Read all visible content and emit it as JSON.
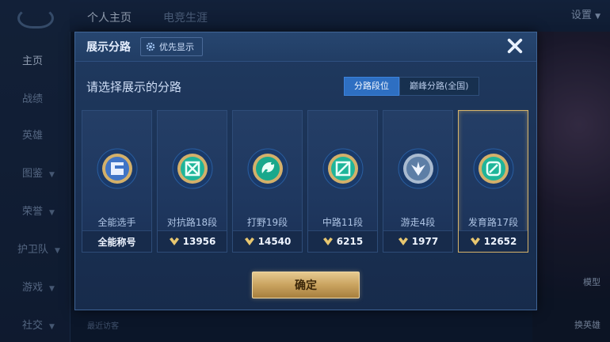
{
  "background": {
    "nav": [
      {
        "label": "主页",
        "active": true
      },
      {
        "label": "战绩",
        "active": false
      },
      {
        "label": "英雄",
        "active": false
      },
      {
        "label": "图鉴",
        "active": false
      },
      {
        "label": "荣誉",
        "active": false
      },
      {
        "label": "护卫队",
        "active": false
      },
      {
        "label": "游戏",
        "active": false
      },
      {
        "label": "社交",
        "active": false
      }
    ],
    "tabs": [
      "个人主页",
      "电竞生涯"
    ],
    "settings_label": "设置",
    "right_labels": [
      "模型",
      "换英雄"
    ],
    "bottom_label": "最近访客"
  },
  "modal": {
    "title": "展示分路",
    "priority_label": "优先显示",
    "subtitle": "请选择展示的分路",
    "toggle": [
      {
        "label": "分路段位",
        "selected": true
      },
      {
        "label": "巅峰分路(全国)",
        "selected": false
      }
    ],
    "cards": [
      {
        "name": "全能选手",
        "footer": "全能称号",
        "show_icon": false,
        "selected": false,
        "badge_color": "#4a7fd0",
        "emblem": "allround"
      },
      {
        "name": "对抗路18段",
        "footer": "13956",
        "show_icon": true,
        "selected": false,
        "badge_color": "#1fb59a",
        "emblem": "clash"
      },
      {
        "name": "打野19段",
        "footer": "14540",
        "show_icon": true,
        "selected": false,
        "badge_color": "#19a88c",
        "emblem": "jungle"
      },
      {
        "name": "中路11段",
        "footer": "6215",
        "show_icon": true,
        "selected": false,
        "badge_color": "#1fb59a",
        "emblem": "mid"
      },
      {
        "name": "游走4段",
        "footer": "1977",
        "show_icon": true,
        "selected": false,
        "badge_color": "#8fa7c4",
        "emblem": "roam"
      },
      {
        "name": "发育路17段",
        "footer": "12652",
        "show_icon": true,
        "selected": true,
        "badge_color": "#1fb59a",
        "emblem": "farm"
      }
    ],
    "confirm_label": "确定",
    "colors": {
      "accent": "#2e6fc2",
      "gold": "#d7b46a"
    }
  }
}
